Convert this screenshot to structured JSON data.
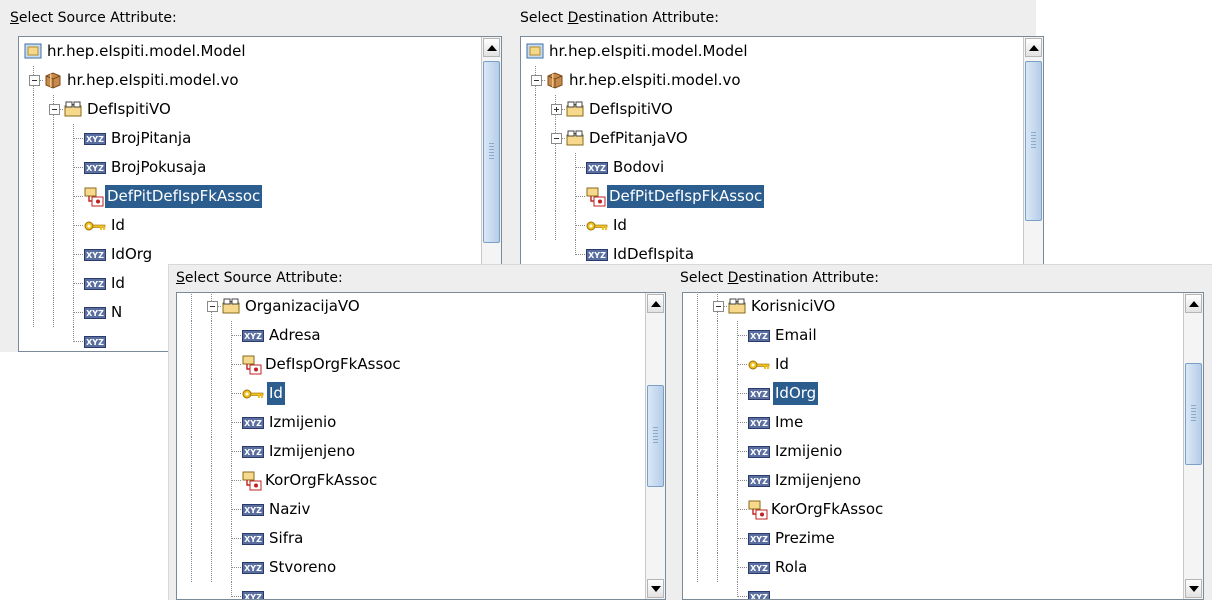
{
  "back_left": {
    "label_pre": "",
    "label_key": "S",
    "label_post": "elect Source Attribute:",
    "rows": [
      {
        "text": "hr.hep.eIspiti.model.Model",
        "icon": "folder-icon",
        "level": 0,
        "toggle": "none",
        "selected": false
      },
      {
        "text": "hr.hep.eIspiti.model.vo",
        "icon": "package-icon",
        "level": 1,
        "toggle": "minus",
        "selected": false
      },
      {
        "text": "DefIspitiVO",
        "icon": "view-object-icon",
        "level": 2,
        "toggle": "minus",
        "selected": false
      },
      {
        "text": "BrojPitanja",
        "icon": "attribute-icon",
        "level": 3,
        "toggle": "none",
        "selected": false
      },
      {
        "text": "BrojPokusaja",
        "icon": "attribute-icon",
        "level": 3,
        "toggle": "none",
        "selected": false
      },
      {
        "text": "DefPitDefIspFkAssoc",
        "icon": "association-icon",
        "level": 3,
        "toggle": "none",
        "selected": true
      },
      {
        "text": "Id",
        "icon": "key-icon",
        "level": 3,
        "toggle": "none",
        "selected": false
      },
      {
        "text": "IdOrg",
        "icon": "attribute-icon",
        "level": 3,
        "toggle": "none",
        "selected": false
      },
      {
        "text": "Id",
        "icon": "attribute-icon",
        "level": 3,
        "toggle": "none",
        "selected": false
      },
      {
        "text": "N",
        "icon": "attribute-icon",
        "level": 3,
        "toggle": "none",
        "selected": false
      },
      {
        "text": "",
        "icon": "attribute-icon",
        "level": 3,
        "toggle": "none",
        "selected": false
      }
    ]
  },
  "back_right": {
    "label_pre": "Select ",
    "label_key": "D",
    "label_post": "estination Attribute:",
    "rows": [
      {
        "text": "hr.hep.eIspiti.model.Model",
        "icon": "folder-icon",
        "level": 0,
        "toggle": "none",
        "selected": false
      },
      {
        "text": "hr.hep.eIspiti.model.vo",
        "icon": "package-icon",
        "level": 1,
        "toggle": "minus",
        "selected": false
      },
      {
        "text": "DefIspitiVO",
        "icon": "view-object-icon",
        "level": 2,
        "toggle": "plus",
        "selected": false
      },
      {
        "text": "DefPitanjaVO",
        "icon": "view-object-icon",
        "level": 2,
        "toggle": "minus",
        "selected": false
      },
      {
        "text": "Bodovi",
        "icon": "attribute-icon",
        "level": 3,
        "toggle": "none",
        "selected": false
      },
      {
        "text": "DefPitDefIspFkAssoc",
        "icon": "association-icon",
        "level": 3,
        "toggle": "none",
        "selected": true
      },
      {
        "text": "Id",
        "icon": "key-icon",
        "level": 3,
        "toggle": "none",
        "selected": false
      },
      {
        "text": "IdDefIspita",
        "icon": "attribute-icon",
        "level": 3,
        "toggle": "none",
        "selected": false
      }
    ]
  },
  "front_left": {
    "label_pre": "",
    "label_key": "S",
    "label_post": "elect Source Attribute:",
    "rows": [
      {
        "text": "OrganizacijaVO",
        "icon": "view-object-icon",
        "level": 2,
        "toggle": "minus",
        "selected": false
      },
      {
        "text": "Adresa",
        "icon": "attribute-icon",
        "level": 3,
        "toggle": "none",
        "selected": false
      },
      {
        "text": "DefIspOrgFkAssoc",
        "icon": "association-icon",
        "level": 3,
        "toggle": "none",
        "selected": false
      },
      {
        "text": "Id",
        "icon": "key-icon",
        "level": 3,
        "toggle": "none",
        "selected": true
      },
      {
        "text": "Izmijenio",
        "icon": "attribute-icon",
        "level": 3,
        "toggle": "none",
        "selected": false
      },
      {
        "text": "Izmijenjeno",
        "icon": "attribute-icon",
        "level": 3,
        "toggle": "none",
        "selected": false
      },
      {
        "text": "KorOrgFkAssoc",
        "icon": "association-icon",
        "level": 3,
        "toggle": "none",
        "selected": false
      },
      {
        "text": "Naziv",
        "icon": "attribute-icon",
        "level": 3,
        "toggle": "none",
        "selected": false
      },
      {
        "text": "Sifra",
        "icon": "attribute-icon",
        "level": 3,
        "toggle": "none",
        "selected": false
      },
      {
        "text": "Stvoreno",
        "icon": "attribute-icon",
        "level": 3,
        "toggle": "none",
        "selected": false
      },
      {
        "text": "",
        "icon": "attribute-icon",
        "level": 3,
        "toggle": "none",
        "selected": false
      }
    ]
  },
  "front_right": {
    "label_pre": "Select ",
    "label_key": "D",
    "label_post": "estination Attribute:",
    "rows": [
      {
        "text": "KorisniciVO",
        "icon": "view-object-icon",
        "level": 2,
        "toggle": "minus",
        "selected": false
      },
      {
        "text": "Email",
        "icon": "attribute-icon",
        "level": 3,
        "toggle": "none",
        "selected": false
      },
      {
        "text": "Id",
        "icon": "key-icon",
        "level": 3,
        "toggle": "none",
        "selected": false
      },
      {
        "text": "IdOrg",
        "icon": "attribute-icon",
        "level": 3,
        "toggle": "none",
        "selected": true
      },
      {
        "text": "Ime",
        "icon": "attribute-icon",
        "level": 3,
        "toggle": "none",
        "selected": false
      },
      {
        "text": "Izmijenio",
        "icon": "attribute-icon",
        "level": 3,
        "toggle": "none",
        "selected": false
      },
      {
        "text": "Izmijenjeno",
        "icon": "attribute-icon",
        "level": 3,
        "toggle": "none",
        "selected": false
      },
      {
        "text": "KorOrgFkAssoc",
        "icon": "association-icon",
        "level": 3,
        "toggle": "none",
        "selected": false
      },
      {
        "text": "Prezime",
        "icon": "attribute-icon",
        "level": 3,
        "toggle": "none",
        "selected": false
      },
      {
        "text": "Rola",
        "icon": "attribute-icon",
        "level": 3,
        "toggle": "none",
        "selected": false
      },
      {
        "text": "",
        "icon": "attribute-icon",
        "level": 3,
        "toggle": "none",
        "selected": false
      }
    ]
  },
  "colors": {
    "selection": "#2b5d8f",
    "panel": "#eeeeee",
    "border": "#7a8a99"
  }
}
